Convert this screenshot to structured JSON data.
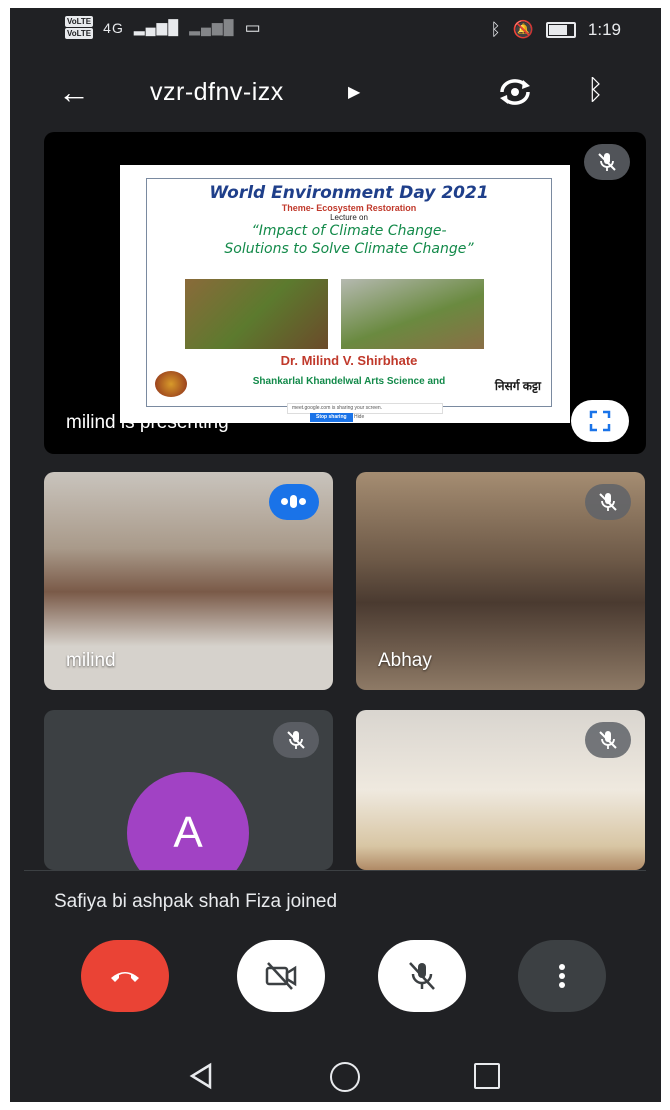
{
  "status_bar": {
    "volte1": "VoLTE",
    "volte2": "VoLTE",
    "network": "4G",
    "time": "1:19"
  },
  "app_bar": {
    "meeting_code": "vzr-dfnv-izx"
  },
  "presentation": {
    "presenter_label": "milind is presenting",
    "slide": {
      "title": "World Environment Day 2021",
      "theme": "Theme- Ecosystem Restoration",
      "lecture_on": "Lecture on",
      "topic_line1": "“Impact of Climate Change-",
      "topic_line2": "Solutions to Solve Climate Change”",
      "speaker": "Dr. Milind V. Shirbhate",
      "college": "Shankarlal Khandelwal Arts Science and",
      "logo_text": "निसर्ग कट्टा",
      "share_bar_text": "meet.google.com is sharing your screen.",
      "share_bar_button": "Stop sharing",
      "share_bar_hide": "Hide"
    }
  },
  "participants": [
    {
      "name": "milind",
      "status": "speaking"
    },
    {
      "name": "Abhay",
      "status": "muted"
    },
    {
      "name": "",
      "avatar_letter": "A",
      "status": "muted"
    },
    {
      "name": "",
      "status": "muted"
    }
  ],
  "toast": {
    "message": "Safiya bi ashpak shah Fiza joined"
  },
  "controls": {
    "end_call_icon": "phone-hangup-icon",
    "camera_icon": "camera-off-icon",
    "mic_icon": "mic-off-icon",
    "more_icon": "more-vert-icon"
  },
  "colors": {
    "background": "#202124",
    "end_call": "#ea4335",
    "speaking_badge": "#1a73e8",
    "avatar": "#a142c4"
  }
}
